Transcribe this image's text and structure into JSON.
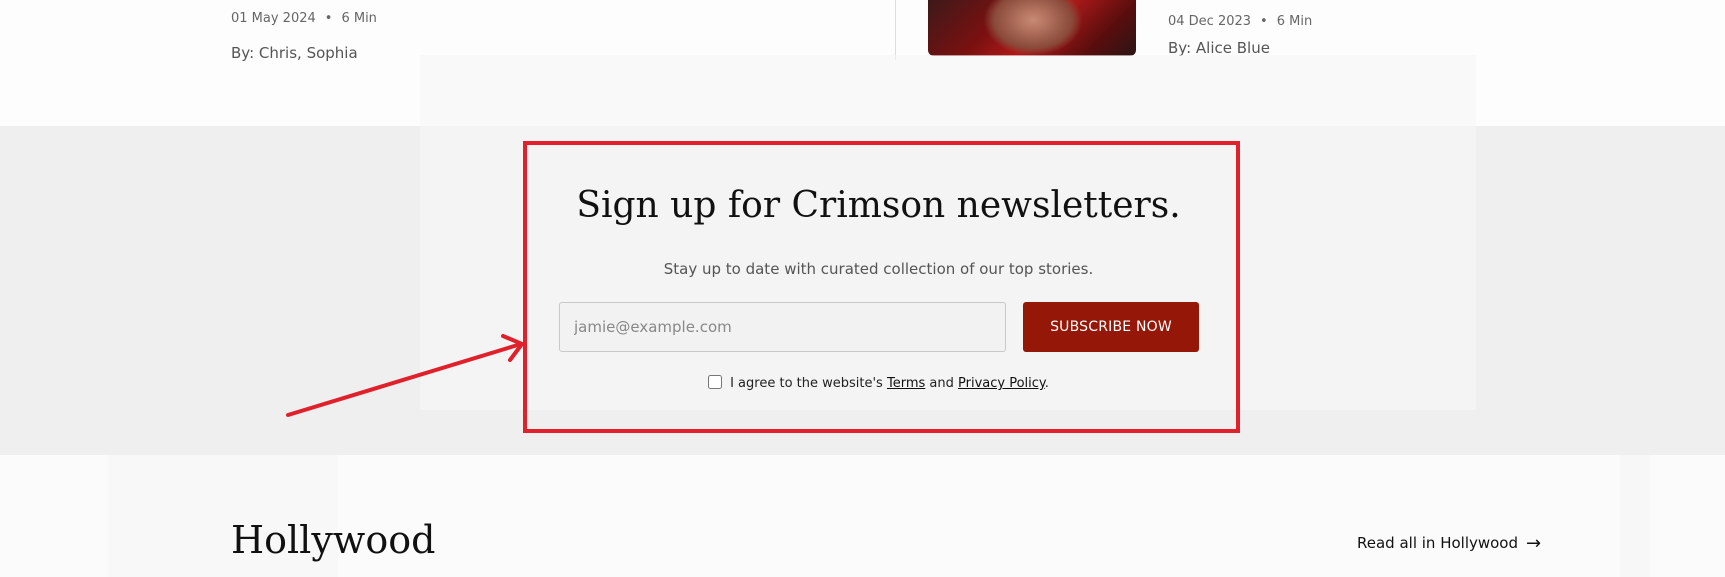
{
  "articles": [
    {
      "date": "01 May 2024",
      "read_time": "6 Min",
      "byline": "By: Chris, Sophia"
    },
    {
      "date": "04 Dec 2023",
      "read_time": "6 Min",
      "byline": "By: Alice Blue"
    }
  ],
  "newsletter": {
    "title": "Sign up for Crimson newsletters.",
    "subtitle": "Stay up to date with curated collection of our top stories.",
    "email_placeholder": "jamie@example.com",
    "subscribe_label": "SUBSCRIBE NOW",
    "consent_prefix": "I agree to the website's",
    "terms_label": "Terms",
    "consent_and": "and",
    "privacy_label": "Privacy Policy",
    "consent_suffix": "."
  },
  "section": {
    "title": "Hollywood",
    "read_all_label": "Read all in Hollywood"
  },
  "icons": {
    "separator": "bullet-icon",
    "read_all": "arrow-right-icon"
  },
  "colors": {
    "accent": "#951707",
    "annotation": "#e0202a",
    "band": "#efefef"
  }
}
